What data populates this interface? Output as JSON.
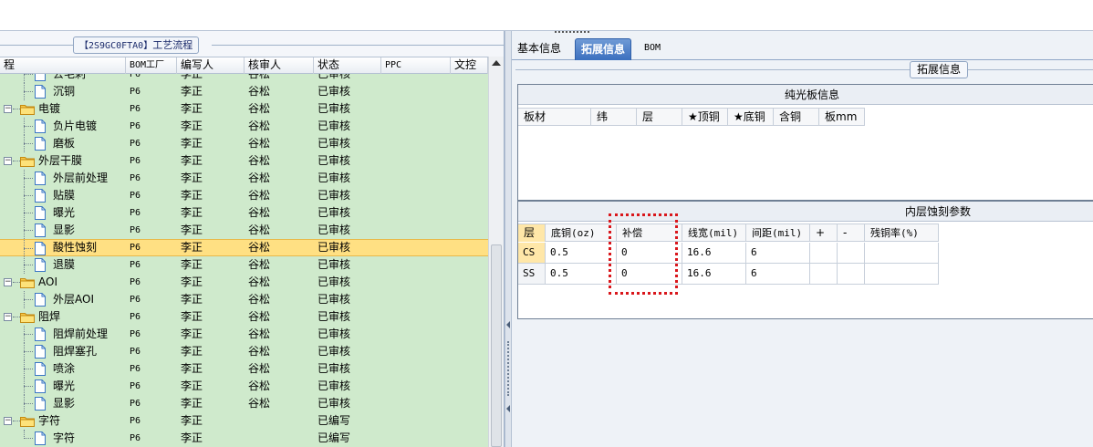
{
  "left": {
    "caption_code": "【2S9GC0FTA0】",
    "caption_text": "工艺流程",
    "columns": [
      "程",
      "BOM工厂",
      "编写人",
      "核审人",
      "状态",
      "PPC",
      "文控"
    ],
    "rows": [
      {
        "name": "去毛刺",
        "kind": "doc",
        "bom": "P6",
        "writer": "李正",
        "reviewer": "谷松",
        "status": "已审核"
      },
      {
        "name": "沉铜",
        "kind": "doc",
        "bom": "P6",
        "writer": "李正",
        "reviewer": "谷松",
        "status": "已审核"
      },
      {
        "name": "电镀",
        "kind": "folder",
        "bom": "P6",
        "writer": "李正",
        "reviewer": "谷松",
        "status": "已审核"
      },
      {
        "name": "负片电镀",
        "kind": "doc",
        "bom": "P6",
        "writer": "李正",
        "reviewer": "谷松",
        "status": "已审核"
      },
      {
        "name": "磨板",
        "kind": "doc",
        "bom": "P6",
        "writer": "李正",
        "reviewer": "谷松",
        "status": "已审核"
      },
      {
        "name": "外层干膜",
        "kind": "folder",
        "bom": "P6",
        "writer": "李正",
        "reviewer": "谷松",
        "status": "已审核"
      },
      {
        "name": "外层前处理",
        "kind": "doc",
        "bom": "P6",
        "writer": "李正",
        "reviewer": "谷松",
        "status": "已审核"
      },
      {
        "name": "贴膜",
        "kind": "doc",
        "bom": "P6",
        "writer": "李正",
        "reviewer": "谷松",
        "status": "已审核"
      },
      {
        "name": "曝光",
        "kind": "doc",
        "bom": "P6",
        "writer": "李正",
        "reviewer": "谷松",
        "status": "已审核"
      },
      {
        "name": "显影",
        "kind": "doc",
        "bom": "P6",
        "writer": "李正",
        "reviewer": "谷松",
        "status": "已审核"
      },
      {
        "name": "酸性蚀刻",
        "kind": "doc",
        "bom": "P6",
        "writer": "李正",
        "reviewer": "谷松",
        "status": "已审核",
        "selected": true
      },
      {
        "name": "退膜",
        "kind": "doc",
        "bom": "P6",
        "writer": "李正",
        "reviewer": "谷松",
        "status": "已审核"
      },
      {
        "name": "AOI",
        "kind": "folder",
        "bom": "P6",
        "writer": "李正",
        "reviewer": "谷松",
        "status": "已审核"
      },
      {
        "name": "外层AOI",
        "kind": "doc",
        "bom": "P6",
        "writer": "李正",
        "reviewer": "谷松",
        "status": "已审核"
      },
      {
        "name": "阻焊",
        "kind": "folder",
        "bom": "P6",
        "writer": "李正",
        "reviewer": "谷松",
        "status": "已审核"
      },
      {
        "name": "阻焊前处理",
        "kind": "doc",
        "bom": "P6",
        "writer": "李正",
        "reviewer": "谷松",
        "status": "已审核"
      },
      {
        "name": "阻焊塞孔",
        "kind": "doc",
        "bom": "P6",
        "writer": "李正",
        "reviewer": "谷松",
        "status": "已审核"
      },
      {
        "name": "喷涂",
        "kind": "doc",
        "bom": "P6",
        "writer": "李正",
        "reviewer": "谷松",
        "status": "已审核"
      },
      {
        "name": "曝光",
        "kind": "doc",
        "bom": "P6",
        "writer": "李正",
        "reviewer": "谷松",
        "status": "已审核"
      },
      {
        "name": "显影",
        "kind": "doc",
        "bom": "P6",
        "writer": "李正",
        "reviewer": "谷松",
        "status": "已审核"
      },
      {
        "name": "字符",
        "kind": "folder",
        "bom": "P6",
        "writer": "李正",
        "reviewer": "",
        "status": "已编写"
      },
      {
        "name": "字符",
        "kind": "doc",
        "bom": "P6",
        "writer": "李正",
        "reviewer": "",
        "status": "已编写"
      }
    ]
  },
  "right": {
    "tabs": [
      "基本信息",
      "拓展信息",
      "BOM"
    ],
    "active_tab": 1,
    "group_caption": "拓展信息",
    "board_section": {
      "title": "纯光板信息",
      "columns": [
        "板材",
        "纬",
        "层",
        "★顶铜",
        "★底铜",
        "含铜",
        "板mm"
      ]
    },
    "etch_section": {
      "title": "内层蚀刻参数",
      "columns": [
        "层",
        "底铜(oz)",
        "补偿",
        "线宽(mil)",
        "间距(mil)",
        "+",
        "-",
        "残铜率(%)"
      ],
      "rows": [
        {
          "layer": "CS",
          "base": "0.5",
          "comp": "0",
          "width": "16.6",
          "space": "6",
          "plus": "",
          "minus": "",
          "residual": ""
        },
        {
          "layer": "SS",
          "base": "0.5",
          "comp": "0",
          "width": "16.6",
          "space": "6",
          "plus": "",
          "minus": "",
          "residual": ""
        }
      ]
    },
    "highlight_color": "#d9161b"
  },
  "colors": {
    "tree_bg": "#cfeacc",
    "selected_row": "#ffe083",
    "active_tab": "#3b6fbf"
  }
}
